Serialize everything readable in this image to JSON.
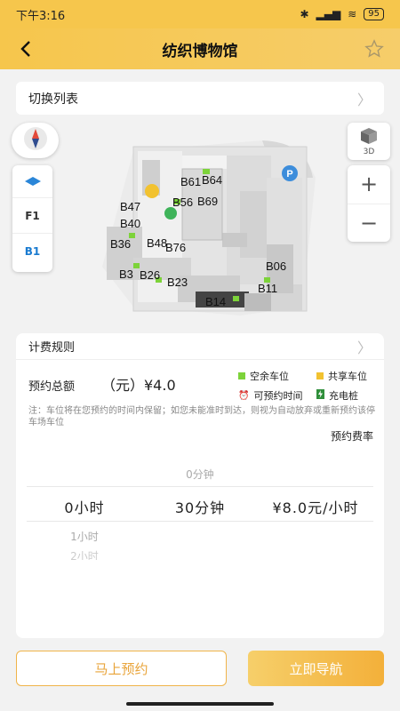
{
  "status": {
    "time": "下午3:16",
    "battery": "95"
  },
  "header": {
    "title": "纺织博物馆"
  },
  "switch_bar": {
    "label": "切换列表"
  },
  "floors": [
    "F1",
    "B1"
  ],
  "btn_3d_label": "3D",
  "map_labels": [
    "B61",
    "B64",
    "B47",
    "B56",
    "B69",
    "B40",
    "B36",
    "B48",
    "B76",
    "B3",
    "B26",
    "B23",
    "B14",
    "B06",
    "B11"
  ],
  "panel": {
    "rule_label": "计费规则",
    "total_label": "预约总额",
    "total_value": "（元）¥4.0",
    "legend": {
      "empty": "空余车位",
      "shared": "共享车位",
      "reservable": "可预约时间",
      "charging": "充电桩"
    },
    "note": "注：车位将在您预约的时间内保留；如您未能准时到达，则视为自动放弃或重新预约该停车场车位",
    "rate_title": "预约费率",
    "picker": {
      "above": "0分钟",
      "selected": [
        "0小时",
        "30分钟",
        "¥8.0元/小时"
      ],
      "below1": "1小时",
      "below2": "2小时"
    }
  },
  "buttons": {
    "reserve": "马上预约",
    "navigate": "立即导航"
  },
  "colors": {
    "accent": "#f6c64c",
    "empty_spot": "#7dd33a",
    "shared_spot": "#f2c230",
    "active_floor": "#1a7bd0"
  }
}
